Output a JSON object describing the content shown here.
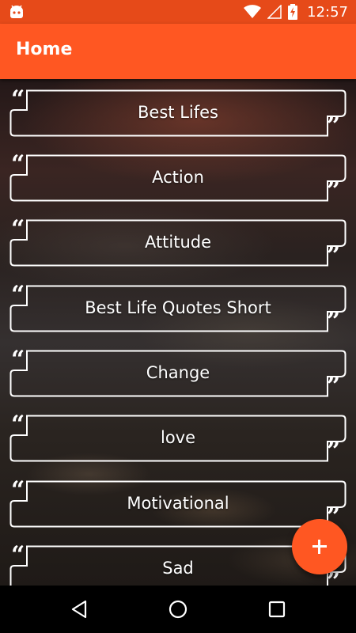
{
  "status_bar": {
    "time": "12:57",
    "icons": [
      "android-icon",
      "wifi-icon",
      "signal-icon",
      "battery-charging-icon"
    ]
  },
  "app_bar": {
    "title": "Home"
  },
  "categories": [
    {
      "label": "Best Lifes"
    },
    {
      "label": "Action"
    },
    {
      "label": "Attitude"
    },
    {
      "label": "Best Life Quotes Short"
    },
    {
      "label": "Change"
    },
    {
      "label": "love"
    },
    {
      "label": "Motivational"
    },
    {
      "label": "Sad"
    }
  ],
  "fab": {
    "icon": "plus-icon"
  },
  "nav_bar": {
    "icons": [
      "back-icon",
      "home-icon",
      "recents-icon"
    ]
  },
  "colors": {
    "status_bar": "#e64a19",
    "app_bar": "#ff5722",
    "fab": "#ff5722",
    "text": "#ffffff"
  }
}
